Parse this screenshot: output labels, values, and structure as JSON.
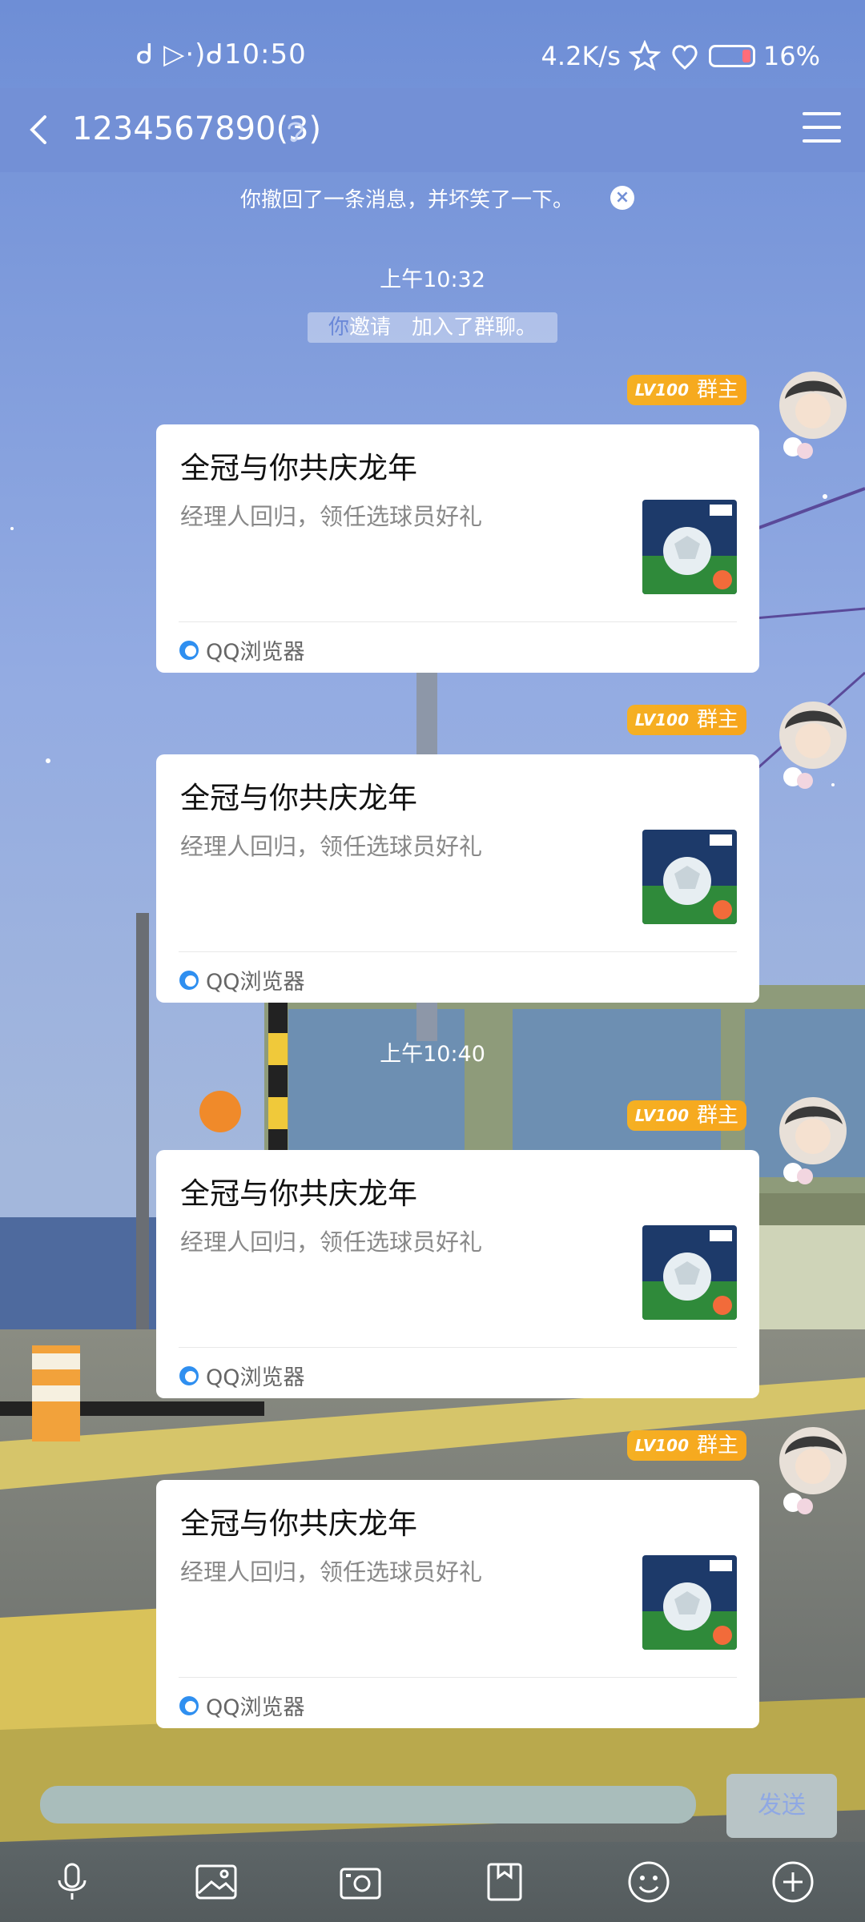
{
  "status_bar": {
    "time": "ᑯ ▷·)ᑯ10:50",
    "net_speed": "4.2K/s",
    "battery": "16%"
  },
  "header": {
    "title": "1234567890(3)",
    "back_icon": "chevron-left-icon",
    "ear_icon": "ear-icon",
    "menu_icon": "hamburger-menu-icon"
  },
  "banner": {
    "text": "你撤回了一条消息，并坏笑了一下。",
    "close_icon": "close-icon"
  },
  "timestamps": [
    "上午10:32",
    "上午10:40"
  ],
  "system_message": {
    "you": "你",
    "rest": "邀请　加入了群聊。"
  },
  "messages": [
    {
      "badge_level": "LV100",
      "badge_role": "群主",
      "title": "全冠与你共庆龙年",
      "desc": "经理人回归，领任选球员好礼",
      "source": "QQ浏览器"
    },
    {
      "badge_level": "LV100",
      "badge_role": "群主",
      "title": "全冠与你共庆龙年",
      "desc": "经理人回归，领任选球员好礼",
      "source": "QQ浏览器"
    },
    {
      "badge_level": "LV100",
      "badge_role": "群主",
      "title": "全冠与你共庆龙年",
      "desc": "经理人回归，领任选球员好礼",
      "source": "QQ浏览器"
    },
    {
      "badge_level": "LV100",
      "badge_role": "群主",
      "title": "全冠与你共庆龙年",
      "desc": "经理人回归，领任选球员好礼",
      "source": "QQ浏览器"
    }
  ],
  "input": {
    "placeholder": "",
    "send_label": "发送"
  },
  "toolbar": [
    "microphone-icon",
    "image-icon",
    "camera-icon",
    "file-icon",
    "emoji-icon",
    "plus-icon"
  ],
  "colors": {
    "header_bg": "#7390d6",
    "badge": "#f5b023",
    "card_bg": "#ffffff"
  }
}
